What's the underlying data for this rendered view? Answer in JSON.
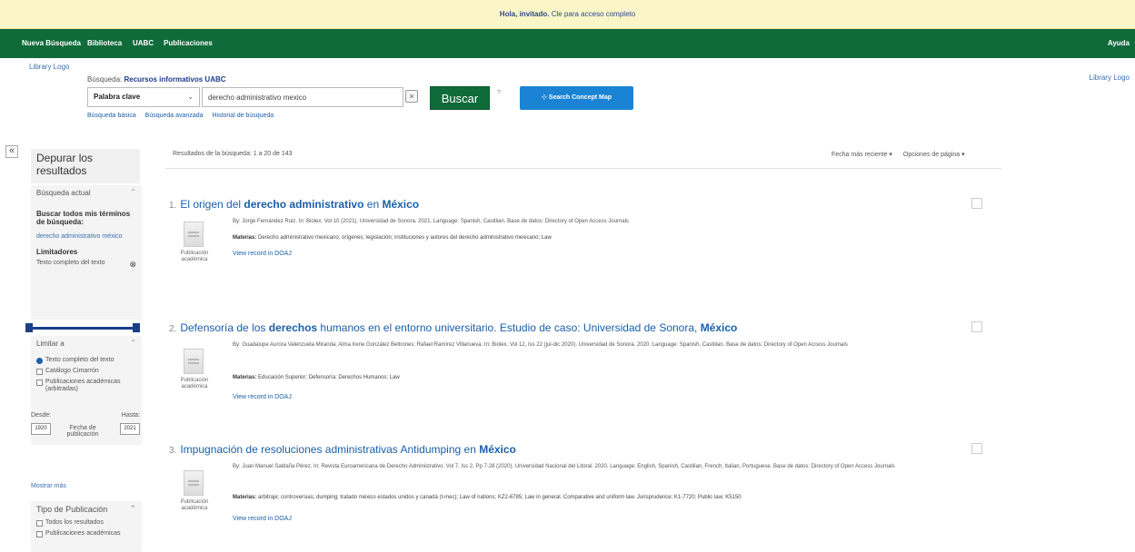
{
  "banner": {
    "hello": "Hola, invitado.",
    "text": "Cle para acceso completo"
  },
  "nav": {
    "items": [
      "Nueva Búsqueda",
      "Biblioteca",
      "UABC",
      "Publicaciones"
    ],
    "right": "Ayuda"
  },
  "logos": {
    "left": "Library Logo",
    "right": "Library Logo"
  },
  "search": {
    "label": "Búsqueda:",
    "scope": "Recursos informativos UABC",
    "field": "Palabra clave",
    "query": "derecho administrativo mexico",
    "clear": "×",
    "button": "Buscar",
    "help": "?",
    "concept_map": "Search Concept Map",
    "links": [
      "Búsqueda básica",
      "Búsqueda avanzada",
      "Historial de búsqueda"
    ]
  },
  "sidebar": {
    "collapse": "«",
    "title": "Depurar los resultados",
    "current_search": {
      "header": "Búsqueda actual",
      "find_all": "Buscar todos mis términos de búsqueda:",
      "term": "derecho administrativo méxico",
      "limiters": "Limitadores",
      "fulltext": "Texto completo del texto"
    },
    "limit_to": {
      "header": "Limitar a",
      "options": [
        "Texto completo del texto",
        "Catálogo Cimarrón",
        "Publicaciones académicas (arbitradas)"
      ],
      "from_label": "Desde:",
      "to_label": "Hasta:",
      "from": "1920",
      "to": "2021",
      "pub_date": "Fecha de publicación"
    },
    "show_more": "Mostrar más",
    "pub_type": {
      "header": "Tipo de Publicación",
      "options": [
        "Todos los resultados",
        "Publicaciones académicas"
      ]
    }
  },
  "results": {
    "count_text": "Resultados de la búsqueda: 1 a 20 de 143",
    "sort": "Fecha más reciente ▾",
    "page_options": "Opciones de página ▾",
    "items": [
      {
        "num": "1.",
        "title_a": "El origen del ",
        "title_b": "derecho administrativo",
        "title_c": " en ",
        "title_d": "México",
        "title_e": "",
        "meta": "By: Jorge Fernández Ruiz. In: Biolex. Vol 10 (2021). Universidad de Sonora. 2021. Language: Spanish, Castilian. Base de datos: Directory of Open Access Journals",
        "subjects_label": "Materias:",
        "subjects": "Derecho administrativo mexicano; orígenes; legislación; instituciones y autores del derecho administrativo mexicano; Law",
        "doc_type": "Publicación académica",
        "link": "View record in DOAJ"
      },
      {
        "num": "2.",
        "title_a": "Defensoría de los ",
        "title_b": "derechos",
        "title_c": " humanos en el entorno universitario. Estudio de caso: Universidad de Sonora, ",
        "title_d": "México",
        "title_e": "",
        "meta": "By: Guadalupe Aurora Valenzuela Miranda; Alma Irene González Beltrones; Rafael Ramírez Villanueva. In: Biolex. Vol 12, Iss 22 (jul-dic 2020). Universidad de Sonora. 2020. Language: Spanish, Castilian. Base de datos: Directory of Open Access Journals",
        "subjects_label": "Materias:",
        "subjects": "Educación Superior; Defensoría; Derechos Humanos; Law",
        "doc_type": "Publicación académica",
        "link": "View record in DOAJ"
      },
      {
        "num": "3.",
        "title_a": "Impugnación de resoluciones administrativas Antidumping en ",
        "title_b": "",
        "title_c": "",
        "title_d": "México",
        "title_e": "",
        "meta": "By: Juan Manuel Saldaña Pérez. In: Revista Euroamericana de Derecho Administrativo. Vol 7, Iss 2, Pp 7-28 (2020). Universidad Nacional del Litoral. 2020. Language: English, Spanish, Castilian, French, Italian, Portuguese. Base de datos: Directory of Open Access Journals",
        "subjects_label": "Materias:",
        "subjects": "arbitraje; controversias; dumping; tratado méxico estados unidos y canadá (t-mec); Law of nations; KZ2-6785; Law in general. Comparative and uniform law. Jurisprudence; K1-7720; Public law; K5150",
        "doc_type": "Publicación académica",
        "link": "View record in DOAJ"
      }
    ]
  }
}
